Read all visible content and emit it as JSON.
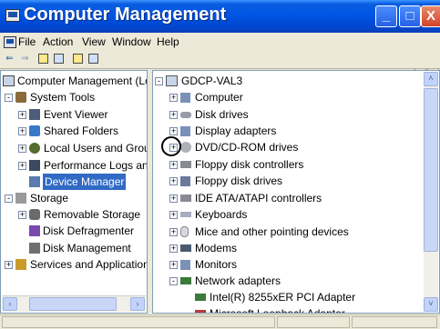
{
  "window": {
    "title": "Computer Management",
    "controls": {
      "minimize": "_",
      "maximize": "□",
      "close": "X"
    }
  },
  "menubar": {
    "items": [
      "File",
      "Action",
      "View",
      "Window",
      "Help"
    ],
    "mdi_min": "_",
    "mdi_restore": "▫"
  },
  "toolbar": {
    "back": "⇐",
    "forward": "⇒"
  },
  "left_tree": {
    "items": [
      {
        "label": "Computer Management (Local)",
        "icon": "computer-management-icon"
      },
      {
        "label": "System Tools",
        "icon": "tools-icon",
        "expander": "-"
      },
      {
        "label": "Event Viewer",
        "icon": "event-viewer-icon",
        "expander": "+"
      },
      {
        "label": "Shared Folders",
        "icon": "shared-folders-icon",
        "expander": "+"
      },
      {
        "label": "Local Users and Groups",
        "icon": "users-icon",
        "expander": "+"
      },
      {
        "label": "Performance Logs and Alerts",
        "icon": "performance-icon",
        "expander": "+"
      },
      {
        "label": "Device Manager",
        "icon": "device-manager-icon",
        "selected": true
      },
      {
        "label": "Storage",
        "icon": "storage-icon",
        "expander": "-"
      },
      {
        "label": "Removable Storage",
        "icon": "removable-storage-icon",
        "expander": "+"
      },
      {
        "label": "Disk Defragmenter",
        "icon": "defrag-icon"
      },
      {
        "label": "Disk Management",
        "icon": "disk-management-icon"
      },
      {
        "label": "Services and Applications",
        "icon": "services-icon",
        "expander": "+"
      }
    ]
  },
  "right_tree": {
    "root": {
      "label": "GDCP-VAL3",
      "expander": "-"
    },
    "items": [
      {
        "label": "Computer",
        "icon": "computer-icon",
        "expander": "+"
      },
      {
        "label": "Disk drives",
        "icon": "disk-drive-icon",
        "expander": "+"
      },
      {
        "label": "Display adapters",
        "icon": "display-adapter-icon",
        "expander": "+"
      },
      {
        "label": "DVD/CD-ROM drives",
        "icon": "dvd-icon",
        "expander": "+"
      },
      {
        "label": "Floppy disk controllers",
        "icon": "floppy-controller-icon",
        "expander": "+"
      },
      {
        "label": "Floppy disk drives",
        "icon": "floppy-drive-icon",
        "expander": "+"
      },
      {
        "label": "IDE ATA/ATAPI controllers",
        "icon": "ide-controller-icon",
        "expander": "+"
      },
      {
        "label": "Keyboards",
        "icon": "keyboard-icon",
        "expander": "+"
      },
      {
        "label": "Mice and other pointing devices",
        "icon": "mouse-icon",
        "expander": "+"
      },
      {
        "label": "Modems",
        "icon": "modem-icon",
        "expander": "+"
      },
      {
        "label": "Monitors",
        "icon": "monitor-icon",
        "expander": "+"
      },
      {
        "label": "Network adapters",
        "icon": "network-adapter-icon",
        "expander": "-"
      },
      {
        "label": "Intel(R) 8255xER PCI Adapter",
        "icon": "network-card-icon",
        "child": true
      },
      {
        "label": "Microsoft Loopback Adapter",
        "icon": "network-card-icon",
        "child": true
      }
    ]
  },
  "scroll": {
    "left": "‹",
    "right": "›",
    "up": "˄",
    "down": "˅"
  },
  "colors": {
    "titlebar": "#0055e5",
    "selection": "#316ac5",
    "pane_border": "#7f9db9"
  }
}
